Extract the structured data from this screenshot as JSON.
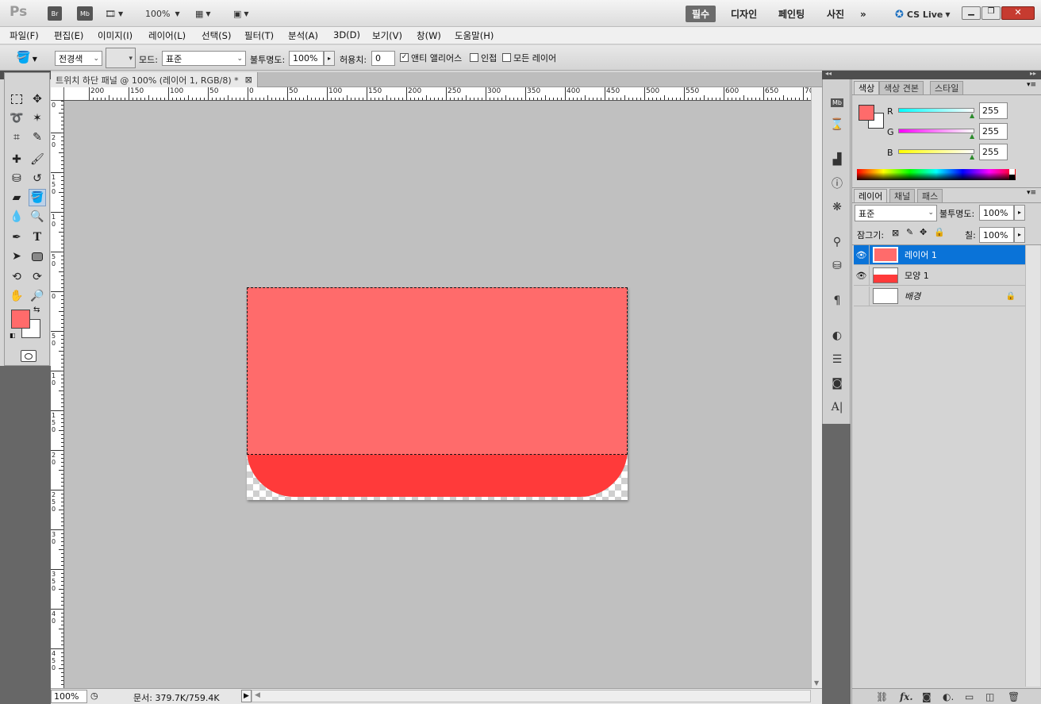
{
  "app": {
    "logo": "Ps",
    "top_buttons": [
      "Br",
      "Mb"
    ],
    "zoom": "100%",
    "workspaces": [
      "필수",
      "디자인",
      "페인팅",
      "사진"
    ],
    "more": "»",
    "cs_live": "CS Live"
  },
  "menu": [
    "파일(F)",
    "편집(E)",
    "이미지(I)",
    "레이어(L)",
    "선택(S)",
    "필터(T)",
    "분석(A)",
    "3D(D)",
    "보기(V)",
    "창(W)",
    "도움말(H)"
  ],
  "options": {
    "fill_source": "전경색",
    "mode_label": "모드:",
    "mode_value": "표준",
    "opacity_label": "불투명도:",
    "opacity_value": "100%",
    "tolerance_label": "허용치:",
    "tolerance_value": "0",
    "antialias_label": "앤티 앨리어스",
    "contiguous_label": "인접",
    "all_layers_label": "모든 레이어"
  },
  "document": {
    "tab_title": "트위치 하단 패널 @ 100% (레이어 1, RGB/8) *",
    "close": "⊠",
    "ruler_h": [
      "200",
      "150",
      "100",
      "50",
      "0",
      "50",
      "100",
      "150",
      "200",
      "250",
      "300",
      "350",
      "400",
      "450",
      "500",
      "550",
      "600",
      "650",
      "70"
    ],
    "ruler_v": [
      "5 0",
      "2 0",
      "1 5 0",
      "1 0",
      "5 0",
      "0",
      "5 0",
      "1 0",
      "1 5 0",
      "2 0",
      "2 5 0",
      "3 0",
      "3 5 0",
      "4 0",
      "4 5 0"
    ],
    "status_zoom": "100%",
    "status_doc": "문서: 379.7K/759.4K"
  },
  "colors": {
    "foreground": "#ff6b6b",
    "background": "#ffffff",
    "layer1": "#ff6b6b",
    "shape1": "#ff3a3a",
    "selection": "#0a73d8"
  },
  "color_panel": {
    "tabs": [
      "색상",
      "색상 견본",
      "스타일"
    ],
    "r_label": "R",
    "r_value": "255",
    "g_label": "G",
    "g_value": "255",
    "b_label": "B",
    "b_value": "255"
  },
  "layers_panel": {
    "tabs": [
      "레이어",
      "채널",
      "패스"
    ],
    "blend_mode": "표준",
    "opacity_label": "불투명도:",
    "opacity_value": "100%",
    "lock_label": "잠그기:",
    "fill_label": "칠:",
    "fill_value": "100%",
    "layers": [
      {
        "name": "레이어 1",
        "visible": true,
        "selected": true
      },
      {
        "name": "모양 1",
        "visible": true,
        "selected": false
      },
      {
        "name": "배경",
        "visible": false,
        "selected": false,
        "locked": true
      }
    ],
    "bottom_icons": [
      "link-icon",
      "fx-icon",
      "mask-icon",
      "adjustment-icon",
      "group-icon",
      "new-layer-icon",
      "trash-icon"
    ]
  }
}
